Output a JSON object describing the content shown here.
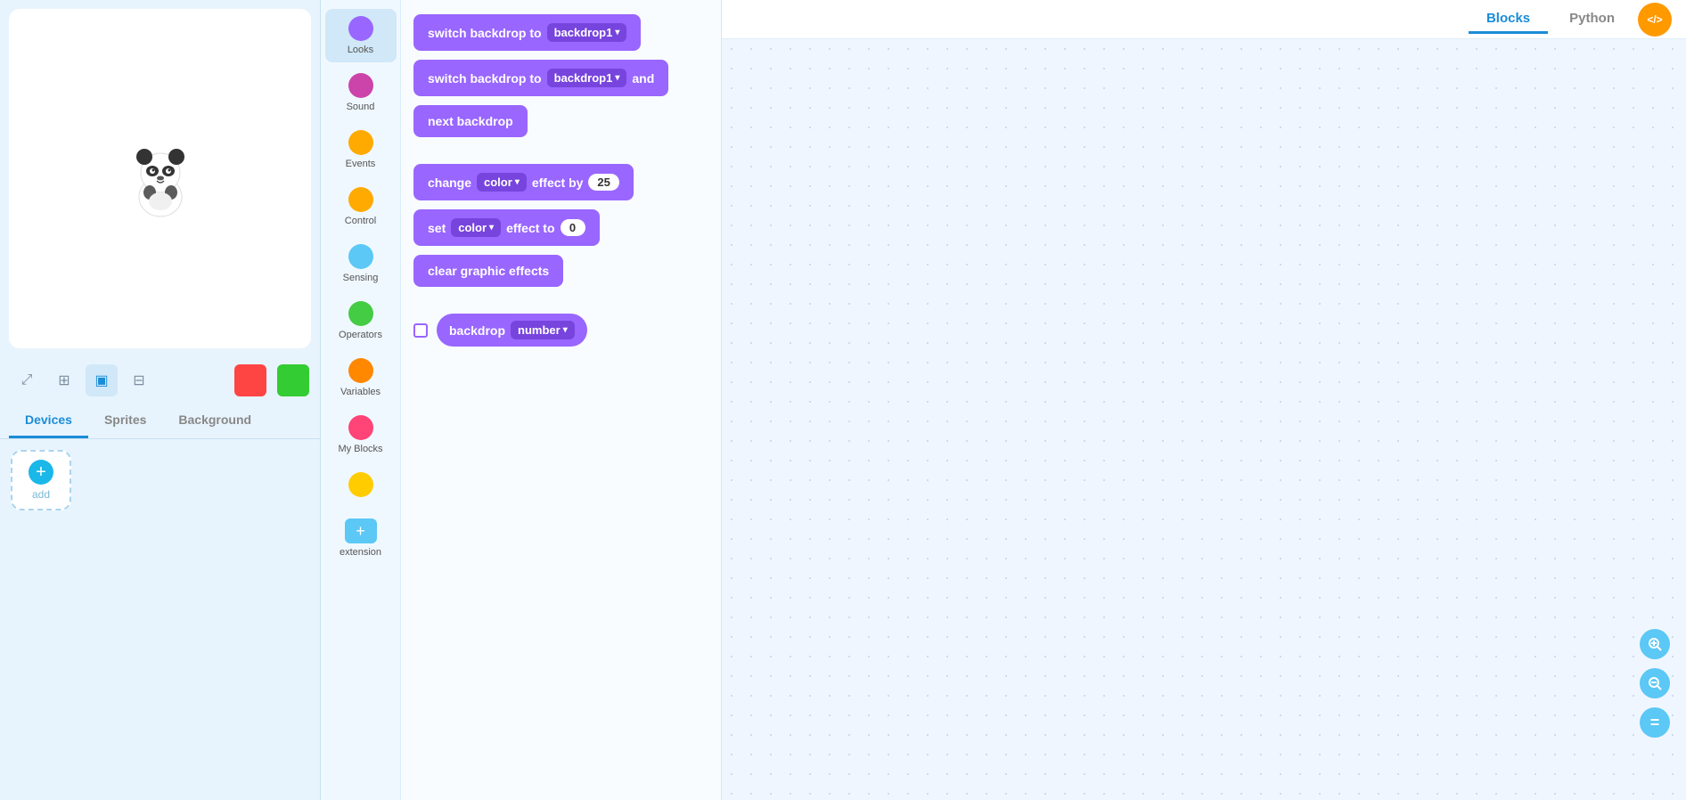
{
  "header": {
    "blocks_tab": "Blocks",
    "python_tab": "Python",
    "code_icon": "</>",
    "blocks_active": true
  },
  "left_panel": {
    "tabs": [
      {
        "id": "devices",
        "label": "Devices",
        "active": true
      },
      {
        "id": "sprites",
        "label": "Sprites",
        "active": false
      },
      {
        "id": "background",
        "label": "Background",
        "active": false
      }
    ],
    "add_button_label": "add",
    "view_buttons": [
      {
        "id": "expand",
        "icon": "⤢",
        "active": false
      },
      {
        "id": "split",
        "icon": "⊞",
        "active": false
      },
      {
        "id": "single",
        "icon": "▣",
        "active": true
      },
      {
        "id": "grid",
        "icon": "⊟",
        "active": false
      }
    ]
  },
  "categories": [
    {
      "id": "looks",
      "label": "Looks",
      "color": "#9966ff",
      "active": true
    },
    {
      "id": "sound",
      "label": "Sound",
      "color": "#cc44aa"
    },
    {
      "id": "events",
      "label": "Events",
      "color": "#ffaa00"
    },
    {
      "id": "control",
      "label": "Control",
      "color": "#ffaa00"
    },
    {
      "id": "sensing",
      "label": "Sensing",
      "color": "#5bc8f5"
    },
    {
      "id": "operators",
      "label": "Operators",
      "color": "#44cc44"
    },
    {
      "id": "variables",
      "label": "Variables",
      "color": "#ff8800"
    },
    {
      "id": "my_blocks",
      "label": "My Blocks",
      "color": "#ff4477"
    },
    {
      "id": "extra",
      "label": "",
      "color": "#ffcc00"
    },
    {
      "id": "extension",
      "label": "extension",
      "color": "#5bc8f5",
      "is_plus": true
    }
  ],
  "blocks": [
    {
      "id": "switch_backdrop_1",
      "type": "command",
      "color": "#9966ff",
      "parts": [
        {
          "type": "text",
          "value": "switch backdrop to"
        },
        {
          "type": "dropdown",
          "value": "backdrop1"
        }
      ]
    },
    {
      "id": "switch_backdrop_wait",
      "type": "command",
      "color": "#9966ff",
      "parts": [
        {
          "type": "text",
          "value": "switch backdrop to"
        },
        {
          "type": "dropdown",
          "value": "backdrop1"
        },
        {
          "type": "text",
          "value": "and"
        }
      ]
    },
    {
      "id": "next_backdrop",
      "type": "command",
      "color": "#9966ff",
      "parts": [
        {
          "type": "text",
          "value": "next backdrop"
        }
      ]
    },
    {
      "id": "change_color_effect",
      "type": "command",
      "color": "#9966ff",
      "parts": [
        {
          "type": "text",
          "value": "change"
        },
        {
          "type": "dropdown",
          "value": "color"
        },
        {
          "type": "text",
          "value": "effect by"
        },
        {
          "type": "input",
          "value": "25"
        }
      ],
      "label": "change color effect by 25"
    },
    {
      "id": "set_color_effect",
      "type": "command",
      "color": "#9966ff",
      "parts": [
        {
          "type": "text",
          "value": "set"
        },
        {
          "type": "dropdown",
          "value": "color"
        },
        {
          "type": "text",
          "value": "effect to"
        },
        {
          "type": "input",
          "value": "0"
        }
      ],
      "label": "set color effect to"
    },
    {
      "id": "clear_graphic_effects",
      "type": "command",
      "color": "#9966ff",
      "parts": [
        {
          "type": "text",
          "value": "clear graphic effects"
        }
      ],
      "label": "clear graphic effects"
    },
    {
      "id": "backdrop_number",
      "type": "reporter",
      "color": "#9966ff",
      "has_checkbox": true,
      "parts": [
        {
          "type": "text",
          "value": "backdrop"
        },
        {
          "type": "dropdown",
          "value": "number"
        }
      ]
    }
  ],
  "action_buttons": [
    {
      "id": "zoom-in",
      "icon": "🔍+"
    },
    {
      "id": "zoom-out",
      "icon": "🔍-"
    },
    {
      "id": "reset",
      "icon": "="
    }
  ],
  "canvas": {
    "background_dots": true
  }
}
